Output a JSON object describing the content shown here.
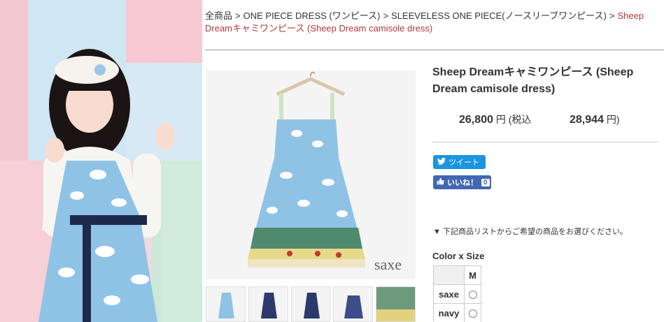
{
  "breadcrumb": {
    "items": [
      "全商品",
      "ONE PIECE DRESS (ワンピース)",
      "SLEEVELESS ONE PIECE(ノースリーブワンピース)"
    ],
    "current": "Sheep Dreamキャミワンピース (Sheep Dream camisole dress)",
    "separator": ">"
  },
  "product": {
    "title": "Sheep Dreamキャミワンピース (Sheep Dream camisole dress)",
    "price": "26,800",
    "price_unit": "円 (税込",
    "price_tax": "28,944",
    "price_tax_unit": "円)",
    "image_caption": "saxe"
  },
  "social": {
    "tweet_label": "ツイート",
    "like_label": "いいね！",
    "like_count": "0"
  },
  "notice": "▼ 下記商品リストからご希望の商品をお選びください。",
  "options": {
    "label": "Color x Size",
    "size_header": "M",
    "colors": [
      "saxe",
      "navy"
    ]
  },
  "colors": {
    "accent_link": "#b0393b",
    "twitter": "#1b95e0",
    "facebook": "#4267b2",
    "dress_blue": "#8fc3e6"
  }
}
